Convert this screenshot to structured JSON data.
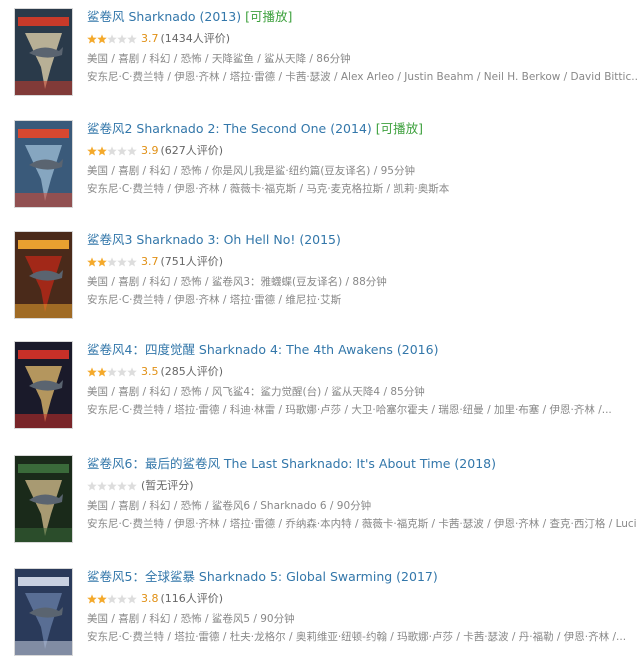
{
  "colors": {
    "title": "#3377aa",
    "playable": "#3ea13e",
    "score": "#e09015",
    "star_on": "#f4a92b",
    "star_off": "#dddddd",
    "meta": "#888888"
  },
  "results": [
    {
      "title": "鲨卷风 Sharknado (2013)",
      "playable": "[可播放]",
      "stars_filled": 2,
      "score": "3.7",
      "votes": "(1434人评价)",
      "meta_genres": "美国 / 喜剧 / 科幻 / 恐怖 / 天降鲨鱼 / 鲨从天降 / 86分钟",
      "meta_cast": "安东尼·C·费兰特 / 伊恩·齐林 / 塔拉·雷德 / 卡茜·瑟波 / Alex Arleo / Justin Beahm / Neil H. Berkow / David Bittic...",
      "poster_icon": "poster-sharknado-1-icon",
      "poster_colors": [
        "#2a3a4a",
        "#c83a2a",
        "#e8d8b0"
      ]
    },
    {
      "title": "鲨卷风2 Sharknado 2: The Second One (2014)",
      "playable": "[可播放]",
      "stars_filled": 2,
      "score": "3.9",
      "votes": "(627人评价)",
      "meta_genres": "美国 / 喜剧 / 科幻 / 恐怖 / 你是风儿我是鲨·纽约篇(豆友译名) / 95分钟",
      "meta_cast": "安东尼·C·费兰特 / 伊恩·齐林 / 薇薇卡·福克斯 / 马克·麦克格拉斯 / 凯莉·奥斯本",
      "poster_icon": "poster-sharknado-2-icon",
      "poster_colors": [
        "#3a5a7a",
        "#d84830",
        "#a0c0d8"
      ]
    },
    {
      "title": "鲨卷风3 Sharknado 3: Oh Hell No! (2015)",
      "playable": "",
      "stars_filled": 2,
      "score": "3.7",
      "votes": "(751人评价)",
      "meta_genres": "美国 / 喜剧 / 科幻 / 恐怖 / 鲨卷风3：雅蠛蝶(豆友译名) / 88分钟",
      "meta_cast": "安东尼·C·费兰特 / 伊恩·齐林 / 塔拉·雷德 / 维尼拉·艾斯",
      "poster_icon": "poster-sharknado-3-icon",
      "poster_colors": [
        "#4a2a1a",
        "#e8a030",
        "#c02818"
      ]
    },
    {
      "title": "鲨卷风4：四度觉醒 Sharknado 4: The 4th Awakens (2016)",
      "playable": "",
      "stars_filled": 2,
      "score": "3.5",
      "votes": "(285人评价)",
      "meta_genres": "美国 / 喜剧 / 科幻 / 恐怖 / 风飞鲨4：鲨力觉醒(台) / 鲨从天降4 / 85分钟",
      "meta_cast": "安东尼·C·费兰特 / 塔拉·雷德 / 科迪·林雷 / 玛歌娜·卢莎 / 大卫·哈塞尔霍夫 / 瑞恩·纽曼 / 加里·布塞 / 伊恩·齐林 /...",
      "poster_icon": "poster-sharknado-4-icon",
      "poster_colors": [
        "#1a1a2a",
        "#c83028",
        "#e8c070"
      ]
    },
    {
      "title": "鲨卷风6：最后的鲨卷风 The Last Sharknado: It's About Time (2018)",
      "playable": "",
      "stars_filled": 0,
      "score": "",
      "votes": "(暂无评分)",
      "meta_genres": "美国 / 喜剧 / 科幻 / 恐怖 / 鲨卷风6 / Sharknado 6 / 90分钟",
      "meta_cast": "安东尼·C·费兰特 / 伊恩·齐林 / 塔拉·雷德 / 乔纳森·本内特 / 薇薇卡·福克斯 / 卡茜·瑟波 / 伊恩·齐林 / 查克·西汀格 / Lucia Os...",
      "poster_icon": "poster-sharknado-6-icon",
      "poster_colors": [
        "#1a2a1a",
        "#3a6a3a",
        "#d8c090"
      ]
    },
    {
      "title": "鲨卷风5：全球鲨暴 Sharknado 5: Global Swarming (2017)",
      "playable": "",
      "stars_filled": 2,
      "score": "3.8",
      "votes": "(116人评价)",
      "meta_genres": "美国 / 喜剧 / 科幻 / 恐怖 / 鲨卷风5 / 90分钟",
      "meta_cast": "安东尼·C·费兰特 / 塔拉·雷德 / 杜夫·龙格尔 / 奥莉维亚·纽顿-约翰 / 玛歌娜·卢莎 / 卡茜·瑟波 / 丹·福勒 / 伊恩·齐林 /...",
      "poster_icon": "poster-sharknado-5-icon",
      "poster_colors": [
        "#2a3a5a",
        "#c8d0e0",
        "#6a80a8"
      ]
    }
  ]
}
